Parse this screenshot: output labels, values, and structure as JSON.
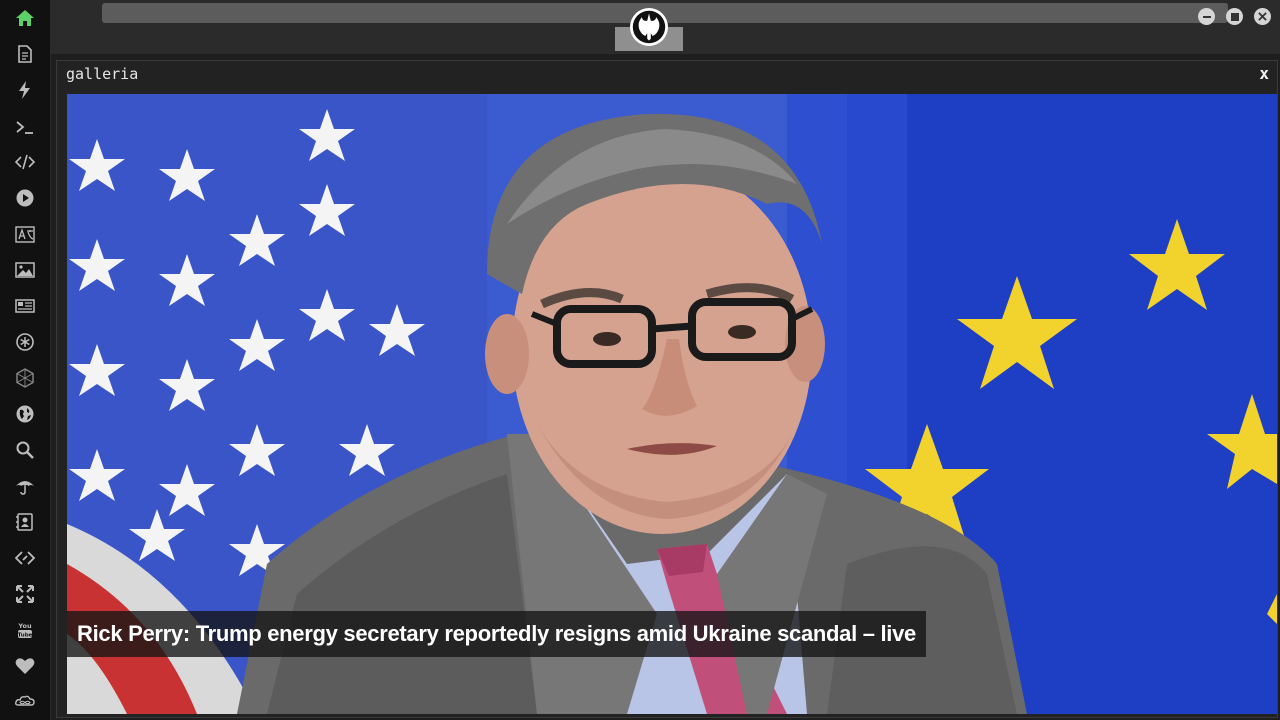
{
  "sidebar": {
    "items": [
      {
        "icon": "home-icon",
        "color": "#5bd16a"
      },
      {
        "icon": "document-icon"
      },
      {
        "icon": "lightning-icon"
      },
      {
        "icon": "terminal-icon"
      },
      {
        "icon": "code-icon"
      },
      {
        "icon": "play-icon"
      },
      {
        "icon": "translate-icon"
      },
      {
        "icon": "image-icon"
      },
      {
        "icon": "newspaper-icon"
      },
      {
        "icon": "asterisk-circle-icon"
      },
      {
        "icon": "hexagon-icon"
      },
      {
        "icon": "globe-icon"
      },
      {
        "icon": "search-icon"
      },
      {
        "icon": "umbrella-icon"
      },
      {
        "icon": "contact-book-icon"
      },
      {
        "icon": "diamond-code-icon"
      },
      {
        "icon": "expand-icon"
      },
      {
        "icon": "youtube-icon"
      },
      {
        "icon": "heart-icon"
      },
      {
        "icon": "infinity-cloud-icon"
      }
    ]
  },
  "window": {
    "logo_icon": "rebel-alliance-logo-icon",
    "controls": [
      "minimize-icon",
      "maximize-icon",
      "close-icon"
    ]
  },
  "panel": {
    "title": "galleria",
    "close_label": "x"
  },
  "gallery": {
    "caption": "Rick Perry: Trump energy secretary reportedly resigns amid Ukraine scandal – live"
  },
  "colors": {
    "sidebar_bg": "#111111",
    "accent_green": "#5bd16a",
    "flag_blue": "#1f3fbf",
    "star_yellow": "#f2d22c"
  }
}
